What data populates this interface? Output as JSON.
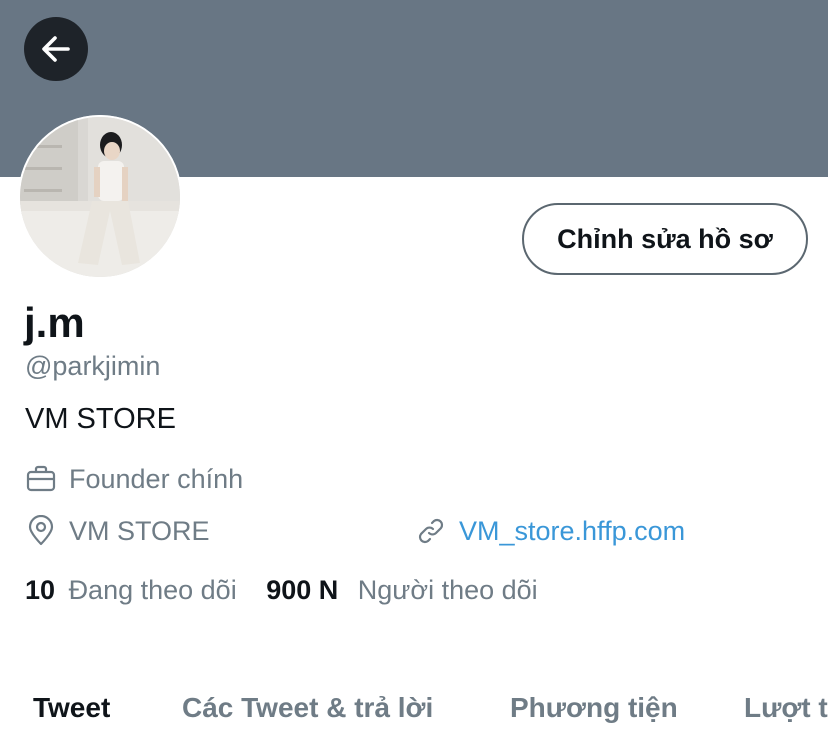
{
  "banner": {
    "color": "#687684"
  },
  "header": {
    "back_icon": "arrow-left-icon"
  },
  "profile": {
    "edit_button_label": "Chỉnh sửa hồ sơ",
    "name": "j.m",
    "handle": "@parkjimin",
    "bio": "VM STORE",
    "profession": "Founder chính",
    "location": "VM STORE",
    "website": "VM_store.hffp.com",
    "following_count": "10",
    "following_label": "Đang theo dõi",
    "followers_count": "900 N",
    "followers_label": "Người theo dõi"
  },
  "icons": {
    "profession": "briefcase-icon",
    "location": "location-pin-icon",
    "website": "link-icon"
  },
  "tabs": [
    {
      "label": "Tweet",
      "active": true
    },
    {
      "label": "Các Tweet & trả lời",
      "active": false
    },
    {
      "label": "Phương tiện",
      "active": false
    },
    {
      "label": "Lượt t",
      "active": false
    }
  ],
  "colors": {
    "text_primary": "#0f1419",
    "text_secondary": "#6f7c86",
    "link": "#3a97d8"
  }
}
